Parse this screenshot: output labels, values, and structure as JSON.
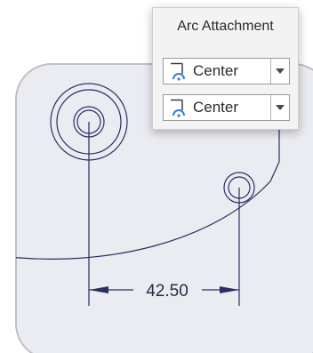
{
  "popup": {
    "title": "Arc Attachment",
    "selects": [
      {
        "value": "Center",
        "icon": "arc-center-attachment-icon"
      },
      {
        "value": "Center",
        "icon": "arc-center-attachment-icon"
      }
    ],
    "dropdown_icon": "chevron-down-icon"
  },
  "dimension": {
    "value": "42.50"
  },
  "colors": {
    "sheet_fill": "#eaecf2",
    "sheet_border": "#bdbfc6",
    "geometry_stroke": "#2b2d63",
    "panel_bg": "#f3f3f3",
    "icon_accent": "#2f7de1"
  }
}
